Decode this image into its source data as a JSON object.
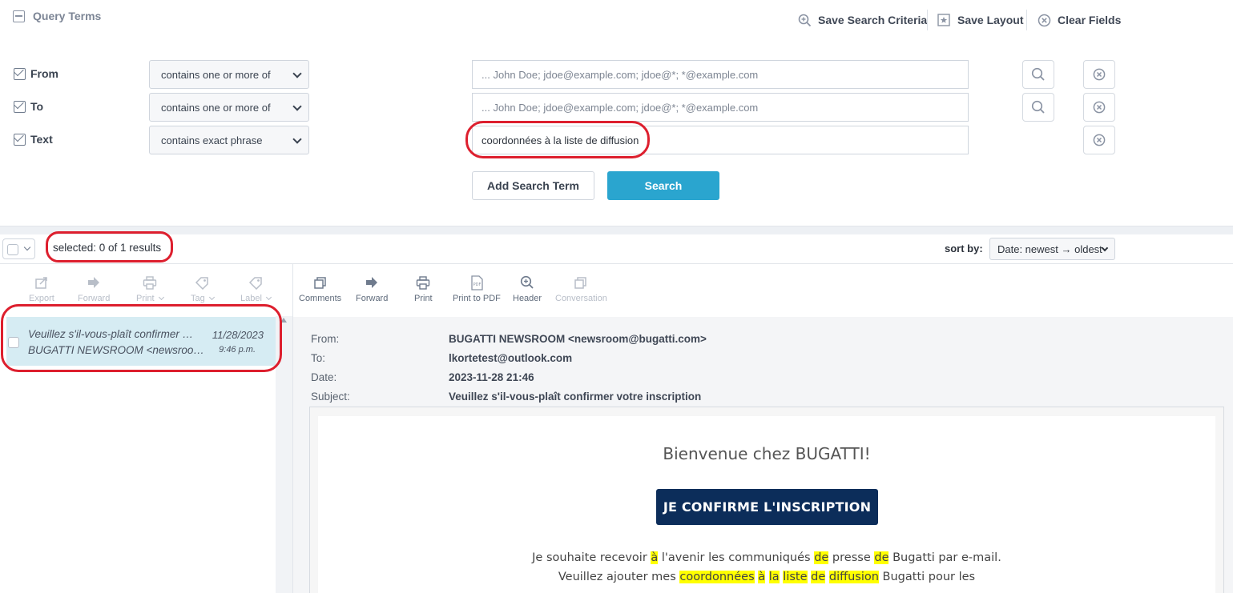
{
  "query": {
    "title": "Query Terms",
    "actions": [
      {
        "label": "Save Search Criteria",
        "icon": "zoom-plus-icon"
      },
      {
        "label": "Save Layout",
        "icon": "star-box-icon"
      },
      {
        "label": "Clear Fields",
        "icon": "clear-circle-icon"
      }
    ],
    "rows": [
      {
        "label": "From",
        "operator": "contains one or more of",
        "value": "",
        "placeholder": "... John Doe; jdoe@example.com; jdoe@*; *@example.com"
      },
      {
        "label": "To",
        "operator": "contains one or more of",
        "value": "",
        "placeholder": "... John Doe; jdoe@example.com; jdoe@*; *@example.com"
      },
      {
        "label": "Text",
        "operator": "contains exact phrase",
        "value": "coordonnées à la liste de diffusion",
        "placeholder": ""
      }
    ],
    "add_term_label": "Add Search Term",
    "search_label": "Search"
  },
  "results": {
    "selected_text": "selected: 0 of 1 results",
    "sort_label": "sort by:",
    "sort_value": "Date: newest → oldest"
  },
  "list_toolbar": [
    {
      "label": "Export",
      "icon": "export-icon"
    },
    {
      "label": "Forward",
      "icon": "forward-arrow-icon"
    },
    {
      "label": "Print",
      "icon": "printer-icon"
    },
    {
      "label": "Tag",
      "icon": "tag-icon"
    },
    {
      "label": "Label",
      "icon": "label-tag-icon"
    }
  ],
  "preview_toolbar": [
    {
      "label": "Comments",
      "icon": "comments-icon"
    },
    {
      "label": "Forward",
      "icon": "forward-arrow-icon"
    },
    {
      "label": "Print",
      "icon": "printer-icon"
    },
    {
      "label": "Print to PDF",
      "icon": "pdf-icon"
    },
    {
      "label": "Header",
      "icon": "zoom-plus-icon"
    },
    {
      "label": "Conversation",
      "icon": "conversation-icon"
    }
  ],
  "messages": [
    {
      "subject": "Veuillez s'il-vous-plaît confirmer votre inscription",
      "from": "BUGATTI NEWSROOM <newsroom@bugatti.com>",
      "date": "11/28/2023",
      "time": "9:46 p.m."
    }
  ],
  "preview": {
    "from_label": "From:",
    "from": "BUGATTI NEWSROOM <newsroom@bugatti.com>",
    "to_label": "To:",
    "to": "lkortetest@outlook.com",
    "date_label": "Date:",
    "date": "2023-11-28 21:46",
    "subject_label": "Subject:",
    "subject": "Veuillez s'il-vous-plaît confirmer votre inscription",
    "body": {
      "heading": "Bienvenue chez BUGATTI!",
      "button": "JE CONFIRME L'INSCRIPTION",
      "line1": {
        "a": "Je souhaite recevoir ",
        "h1": "à",
        "b": " l'avenir les communiqués ",
        "h2": "de",
        "c": " presse ",
        "h3": "de",
        "d": " Bugatti par e-mail."
      },
      "line2": {
        "a": "Veuillez ajouter mes ",
        "h1": "coordonnées",
        "s1": " ",
        "h2": "à",
        "s2": " ",
        "h3": "la",
        "s3": " ",
        "h4": "liste",
        "s4": " ",
        "h5": "de",
        "s5": " ",
        "h6": "diffusion",
        "b": " Bugatti pour les"
      }
    }
  },
  "colors": {
    "accent": "#2aa5cf",
    "selected_row": "#d6ecf3",
    "annotation": "#dd1f2e",
    "email_button": "#0c2d5a",
    "highlight": "#ffff00"
  }
}
